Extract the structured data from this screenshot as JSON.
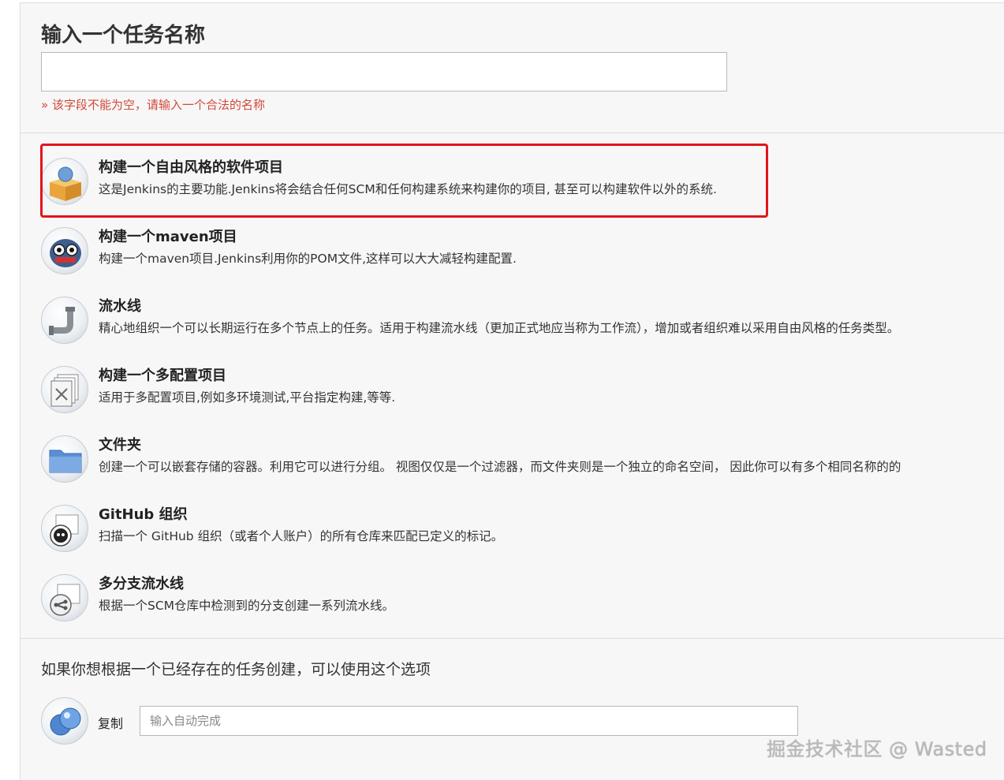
{
  "header": {
    "title": "输入一个任务名称",
    "name_value": "",
    "error": "» 该字段不能为空，请输入一个合法的名称"
  },
  "items": [
    {
      "name": "构建一个自由风格的软件项目",
      "desc": "这是Jenkins的主要功能.Jenkins将会结合任何SCM和任何构建系统来构建你的项目, 甚至可以构建软件以外的系统.",
      "icon": "freestyle-box-icon"
    },
    {
      "name": "构建一个maven项目",
      "desc": "构建一个maven项目.Jenkins利用你的POM文件,这样可以大大减轻构建配置.",
      "icon": "maven-owl-icon"
    },
    {
      "name": "流水线",
      "desc": "精心地组织一个可以长期运行在多个节点上的任务。适用于构建流水线（更加正式地应当称为工作流），增加或者组织难以采用自由风格的任务类型。",
      "icon": "pipeline-pipe-icon"
    },
    {
      "name": "构建一个多配置项目",
      "desc": "适用于多配置项目,例如多环境测试,平台指定构建,等等.",
      "icon": "multi-config-icon"
    },
    {
      "name": "文件夹",
      "desc": "创建一个可以嵌套存储的容器。利用它可以进行分组。 视图仅仅是一个过滤器，而文件夹则是一个独立的命名空间， 因此你可以有多个相同名称的的",
      "icon": "folder-icon"
    },
    {
      "name": "GitHub 组织",
      "desc": "扫描一个 GitHub 组织（或者个人账户）的所有仓库来匹配已定义的标记。",
      "icon": "github-org-icon"
    },
    {
      "name": "多分支流水线",
      "desc": "根据一个SCM仓库中检测到的分支创建一系列流水线。",
      "icon": "multibranch-icon"
    }
  ],
  "copy": {
    "section_title": "如果你想根据一个已经存在的任务创建，可以使用这个选项",
    "label": "复制",
    "placeholder": "输入自动完成"
  },
  "watermark": "掘金技术社区 @ Wasted",
  "colors": {
    "highlight": "#e3141c",
    "error": "#d24939",
    "panel": "#f7f7f7"
  }
}
